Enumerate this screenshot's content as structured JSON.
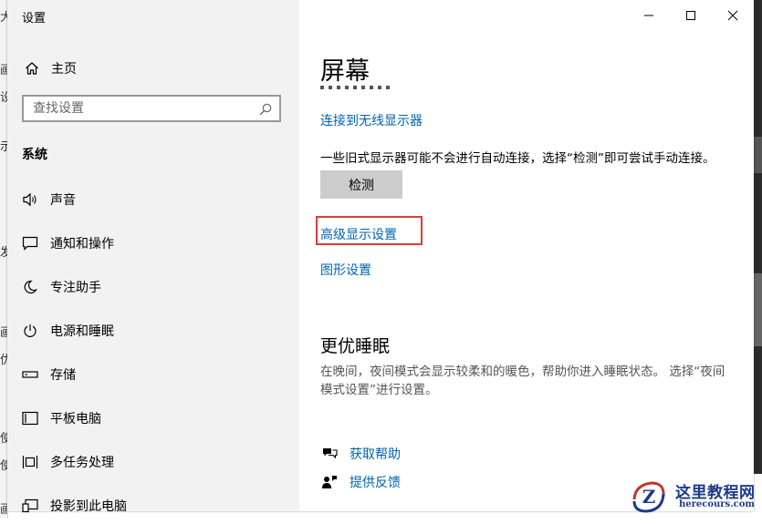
{
  "background": {
    "left_edge_chars": [
      "大",
      "画",
      "设",
      "示",
      "发",
      "画",
      "优",
      "使",
      "使",
      "画"
    ]
  },
  "window": {
    "title": "设置",
    "controls": {
      "minimize_icon": "minimize-icon",
      "maximize_icon": "maximize-icon",
      "close_icon": "close-icon"
    }
  },
  "sidebar": {
    "home_label": "主页",
    "search_placeholder": "查找设置",
    "section_title": "系统",
    "items": [
      {
        "label": "声音",
        "icon": "speaker-icon"
      },
      {
        "label": "通知和操作",
        "icon": "notification-icon"
      },
      {
        "label": "专注助手",
        "icon": "moon-icon"
      },
      {
        "label": "电源和睡眠",
        "icon": "power-icon"
      },
      {
        "label": "存储",
        "icon": "storage-icon"
      },
      {
        "label": "平板电脑",
        "icon": "tablet-icon"
      },
      {
        "label": "多任务处理",
        "icon": "multitask-icon"
      },
      {
        "label": "投影到此电脑",
        "icon": "project-icon"
      }
    ]
  },
  "main": {
    "title": "屏幕",
    "link_wireless": "连接到无线显示器",
    "detect_desc": "一些旧式显示器可能不会进行自动连接，选择“检测”即可尝试手动连接。",
    "detect_button": "检测",
    "link_advanced": "高级显示设置",
    "link_graphics": "图形设置",
    "sleep_title": "更优睡眠",
    "sleep_desc": "在晚间，夜间模式会显示较柔和的暖色，帮助你进入睡眠状态。 选择“夜间模式设置”进行设置。",
    "help_link": "获取帮助",
    "feedback_link": "提供反馈"
  },
  "watermark": {
    "name": "这里教程网",
    "url": "herecours.com"
  },
  "colors": {
    "link": "#0063b1",
    "highlight_border": "#e03a3a",
    "sidebar_bg": "#f2f2f2"
  }
}
